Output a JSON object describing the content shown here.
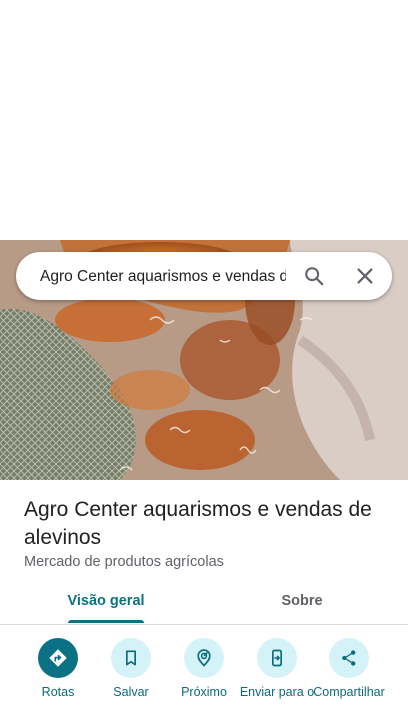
{
  "search": {
    "query": "Agro Center aquarismos e vendas de alevinos"
  },
  "place": {
    "name": "Agro Center aquarismos e vendas de alevinos",
    "category": "Mercado de produtos agrícolas"
  },
  "tabs": [
    {
      "label": "Visão geral",
      "active": true
    },
    {
      "label": "Sobre",
      "active": false
    }
  ],
  "actions": [
    {
      "label": "Rotas",
      "icon": "directions-icon"
    },
    {
      "label": "Salvar",
      "icon": "bookmark-icon"
    },
    {
      "label": "Próximo",
      "icon": "nearby-icon"
    },
    {
      "label": "Enviar para o",
      "icon": "send-to-phone-icon"
    },
    {
      "label": "Compartilhar",
      "icon": "share-icon"
    }
  ],
  "colors": {
    "accent": "#0b7285",
    "action_bg": "#d4f3f8"
  }
}
